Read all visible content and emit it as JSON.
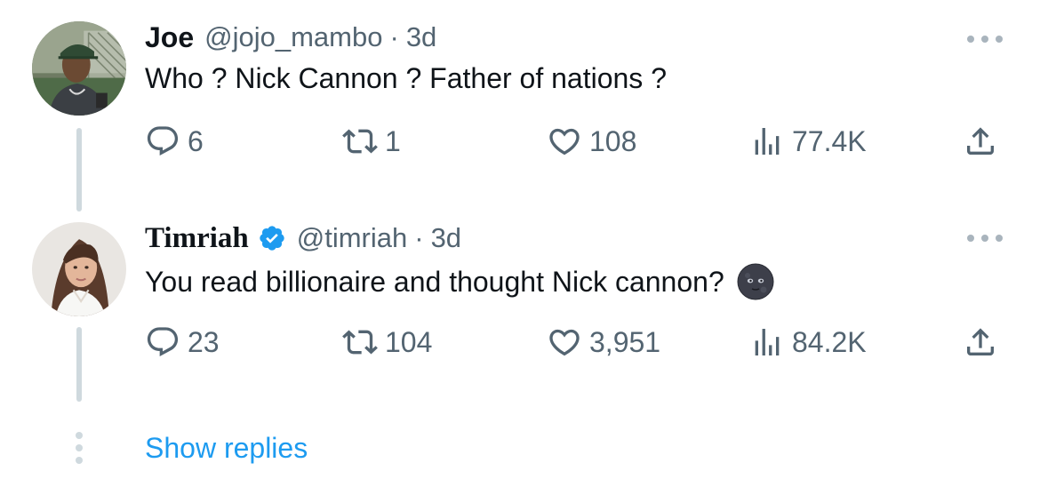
{
  "tweets": [
    {
      "name": "Joe",
      "handle": "@jojo_mambo",
      "separator": "·",
      "time": "3d",
      "text": "Who ? Nick Cannon ? Father of nations ?",
      "replies": "6",
      "retweets": "1",
      "likes": "108",
      "views": "77.4K",
      "verified": false
    },
    {
      "name": "Timriah",
      "handle": "@timriah",
      "separator": "·",
      "time": "3d",
      "text": "You read billionaire and thought Nick cannon?",
      "emoji": "new-moon-face-emoji",
      "replies": "23",
      "retweets": "104",
      "likes": "3,951",
      "views": "84.2K",
      "verified": true
    }
  ],
  "show_replies": "Show replies",
  "colors": {
    "text": "#0f1419",
    "secondary": "#536471",
    "link": "#1d9bf0",
    "verified": "#1d9bf0",
    "thread_line": "#cfd9de"
  }
}
